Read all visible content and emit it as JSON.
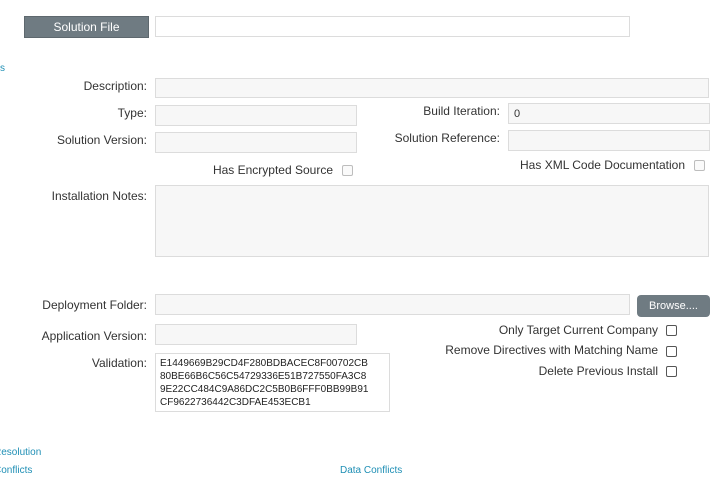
{
  "header": {
    "solution_file_button": "Solution File",
    "solution_file_value": ""
  },
  "left_edge_link": "s",
  "form": {
    "description": {
      "label": "Description:",
      "value": ""
    },
    "type": {
      "label": "Type:",
      "value": ""
    },
    "build_iteration": {
      "label": "Build Iteration:",
      "value": "0"
    },
    "solution_version": {
      "label": "Solution Version:",
      "value": ""
    },
    "solution_reference": {
      "label": "Solution Reference:",
      "value": ""
    },
    "has_encrypted_source": {
      "label": "Has Encrypted Source",
      "checked": false
    },
    "has_xml_docs": {
      "label": "Has XML Code Documentation",
      "checked": false
    },
    "installation_notes": {
      "label": "Installation Notes:",
      "value": ""
    },
    "deployment_folder": {
      "label": "Deployment Folder:",
      "value": "",
      "browse_label": "Browse...."
    },
    "application_version": {
      "label": "Application Version:",
      "value": ""
    },
    "only_target_current_company": {
      "label": "Only Target Current Company",
      "checked": false
    },
    "remove_directives": {
      "label": "Remove Directives with Matching Name",
      "checked": false
    },
    "delete_previous_install": {
      "label": "Delete Previous Install",
      "checked": false
    },
    "validation": {
      "label": "Validation:",
      "lines": [
        "E1449669B29CD4F280BDBACEC8F00702CB",
        "80BE66B6C56C54729336E51B727550FA3C8",
        "9E22CC484C9A86DC2C5B0B6FFF0BB99B91",
        "CF9622736442C3DFAE453ECB1"
      ]
    }
  },
  "footer_links": {
    "resolution": "Resolution",
    "conflicts": "Conflicts",
    "data_conflicts": "Data Conflicts"
  },
  "colors": {
    "button_gray": "#6f7b82",
    "link_blue": "#1f8fb5"
  }
}
